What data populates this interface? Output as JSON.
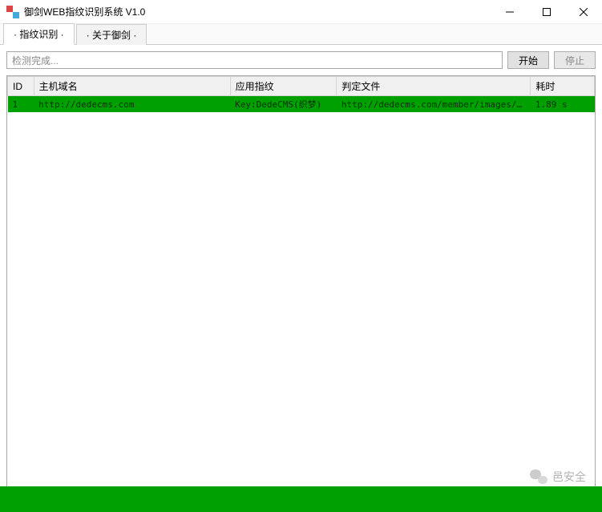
{
  "window": {
    "title": "御剑WEB指纹识别系统 V1.0"
  },
  "tabs": [
    {
      "label": "· 指纹识别 ·",
      "active": true
    },
    {
      "label": "· 关于御剑 ·",
      "active": false
    }
  ],
  "controls": {
    "status_text": "检测完成...",
    "start_label": "开始",
    "stop_label": "停止"
  },
  "columns": {
    "id": "ID",
    "host": "主机域名",
    "fingerprint": "应用指纹",
    "file": "判定文件",
    "time": "耗时"
  },
  "rows": [
    {
      "id": "1",
      "host": "http://dedecms.com",
      "fingerprint": "Key:DedeCMS(织梦)",
      "file": "http://dedecms.com/member/images/ba...",
      "time": "1.89 s"
    }
  ],
  "watermark": {
    "text": "邑安全"
  }
}
